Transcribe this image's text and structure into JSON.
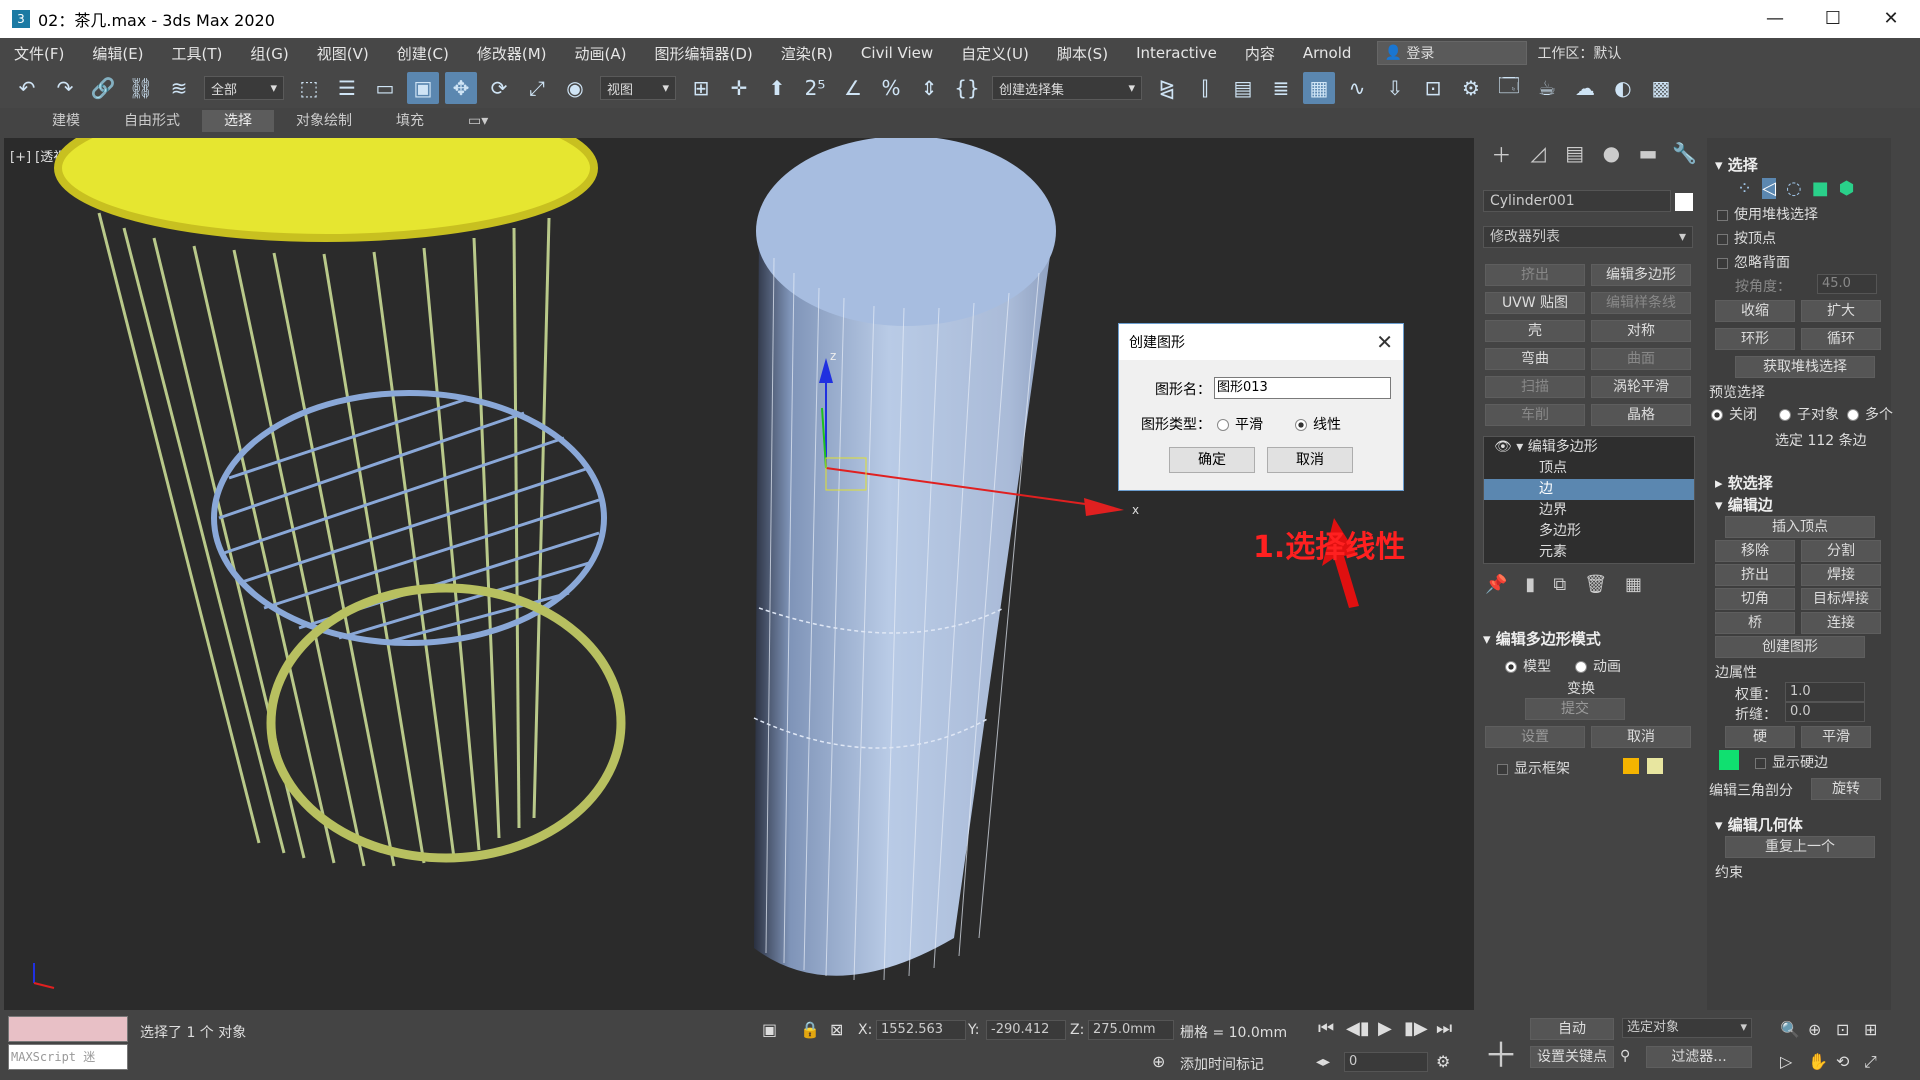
{
  "window": {
    "title": "02：茶几.max - 3ds Max 2020",
    "app_icon": "3",
    "minimize": "—",
    "maximize": "☐",
    "close": "✕"
  },
  "menu": {
    "items": [
      "文件(F)",
      "编辑(E)",
      "工具(T)",
      "组(G)",
      "视图(V)",
      "创建(C)",
      "修改器(M)",
      "动画(A)",
      "图形编辑器(D)",
      "渲染(R)",
      "Civil View",
      "自定义(U)",
      "脚本(S)",
      "Interactive",
      "内容",
      "Arnold"
    ],
    "login": "登录",
    "workspace": "工作区：默认"
  },
  "toolbar": {
    "filter": "全部",
    "view": "视图",
    "selection_set": "创建选择集"
  },
  "ribbon": {
    "tabs": [
      "建模",
      "自由形式",
      "选择",
      "对象绘制",
      "填充"
    ],
    "selected": "选择"
  },
  "viewport": {
    "label": "[+] [透视] [用户定义] [边面]"
  },
  "dialog": {
    "title": "创建图形",
    "name_label": "图形名：",
    "name_value": "图形013",
    "type_label": "图形类型：",
    "opt_smooth": "平滑",
    "opt_linear": "线性",
    "linear_selected": true,
    "ok": "确定",
    "cancel": "取消"
  },
  "annotation": "1.选择线性",
  "panel": {
    "object_name": "Cylinder001",
    "modifier_list": "修改器列表",
    "quick_buttons": [
      "挤出",
      "编辑多边形",
      "UVW 贴图",
      "编辑样条线",
      "壳",
      "对称",
      "弯曲",
      "曲面",
      "扫描",
      "涡轮平滑",
      "车削",
      "晶格"
    ],
    "stack": {
      "top": "编辑多边形",
      "items": [
        "顶点",
        "边",
        "边界",
        "多边形",
        "元素"
      ],
      "selected": "边"
    },
    "mode": {
      "title": "编辑多边形模式",
      "model": "模型",
      "animation": "动画",
      "transform": "变换",
      "commit": "提交",
      "settings": "设置",
      "cancel": "取消",
      "show_cage": "显示框架",
      "cage_color1": "#f5b400",
      "cage_color2": "#e8e6a0"
    }
  },
  "rightpanel": {
    "select": {
      "title": "选择",
      "use_stack": "使用堆栈选择",
      "by_vertex": "按顶点",
      "ignore_back": "忽略背面",
      "by_angle": "按角度：",
      "angle_value": "45.0",
      "shrink": "收缩",
      "grow": "扩大",
      "ring": "环形",
      "loop": "循环",
      "get_stack": "获取堆栈选择",
      "preview": "预览选择",
      "off": "关闭",
      "subobj": "子对象",
      "multi": "多个",
      "selected_info": "选定 112 条边"
    },
    "soft": "软选择",
    "edit_edges": {
      "title": "编辑边",
      "insert_vertex": "插入顶点",
      "remove": "移除",
      "split": "分割",
      "extrude": "挤出",
      "weld": "焊接",
      "chamfer": "切角",
      "target_weld": "目标焊接",
      "bridge": "桥",
      "connect": "连接",
      "create_shape": "创建图形",
      "edge_props": "边属性",
      "weight": "权重：",
      "weight_val": "1.0",
      "crease": "折缝：",
      "crease_val": "0.0",
      "hard": "硬",
      "smooth": "平滑",
      "show_hard": "显示硬边",
      "tri": "编辑三角剖分",
      "turn": "旋转"
    },
    "edit_geom": {
      "title": "编辑几何体",
      "repeat": "重复上一个",
      "constraint": "约束"
    }
  },
  "status": {
    "maxscript": "MAXScript 迷",
    "selected": "选择了 1 个 对象",
    "x_label": "X:",
    "x": "1552.563",
    "y_label": "Y:",
    "y": "-290.412",
    "z_label": "Z:",
    "z": "275.0mm",
    "grid": "栅格 = 10.0mm",
    "add_time_tag": "添加时间标记",
    "frame": "0",
    "auto": "自动",
    "selected_obj": "选定对象",
    "set_key": "设置关键点",
    "filters": "过滤器..."
  }
}
